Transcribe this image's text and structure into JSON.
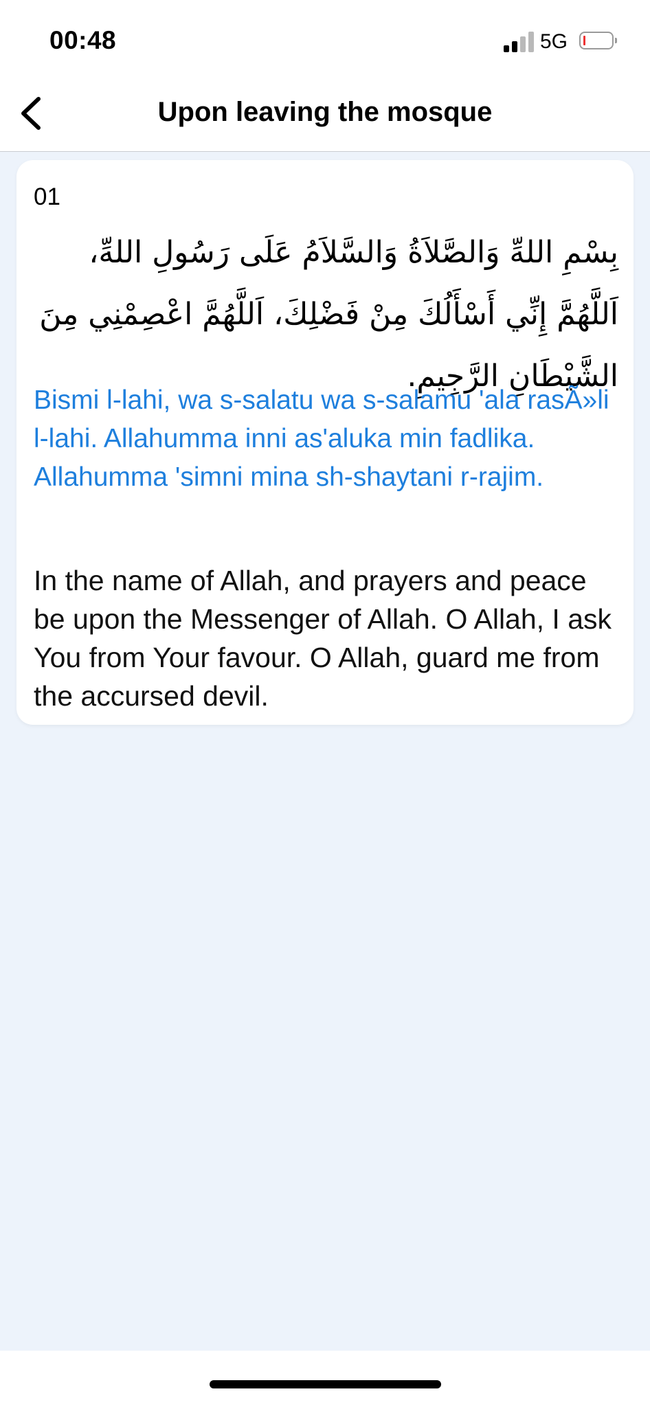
{
  "status_bar": {
    "time": "00:48",
    "network": "5G",
    "icons": {
      "signal": "cellular-signal-icon",
      "battery": "battery-low-icon"
    },
    "colors": {
      "battery_level": "#e33333"
    }
  },
  "header": {
    "back_icon": "chevron-left-icon",
    "title": "Upon leaving the mosque"
  },
  "cards": [
    {
      "number": "01",
      "arabic": "بِسْمِ اللهِّ وَالصَّلاَةُ وَالسَّلاَمُ عَلَى رَسُولِ اللهِّ، اَللَّهُمَّ إِنِّي أَسْأَلُكَ مِنْ فَضْلِكَ، اَللَّهُمَّ اعْصِمْنِي مِنَ الشَّيْطَانِ الرَّجِيمِ.",
      "transliteration": "Bismi l-lahi, wa s-salatu wa s-salamu 'ala rasÃ»li l-lahi. Allahumma inni as'aluka min fadlika. Allahumma 'simni mina sh-shaytani r-rajim.",
      "translation": "In the name of Allah, and prayers and peace be upon the Messenger of Allah. O Allah, I ask You from Your favour. O Allah, guard me from the accursed devil."
    }
  ],
  "theme": {
    "transliteration_color": "#1e7fdd",
    "background_color": "#edf3fb",
    "card_color": "#ffffff"
  }
}
